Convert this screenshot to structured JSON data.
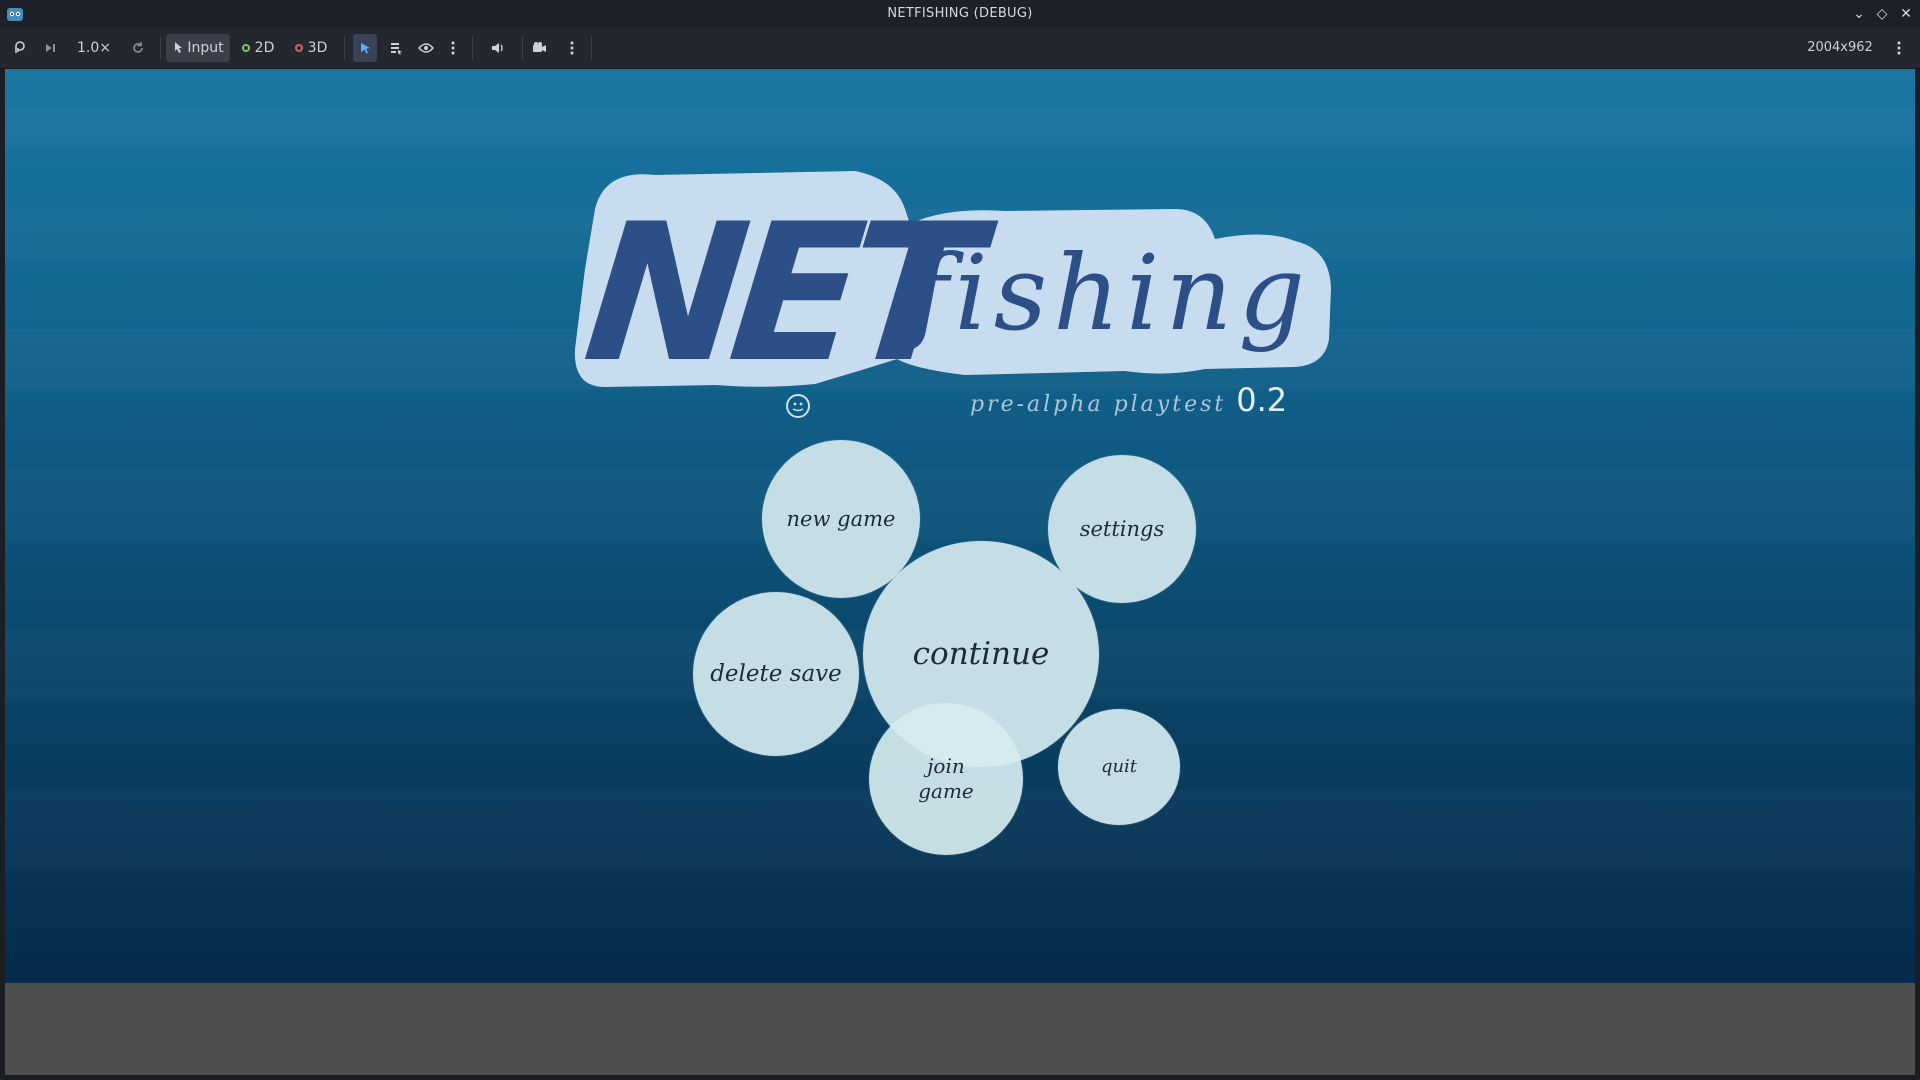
{
  "window": {
    "title": "NETFISHING (DEBUG)"
  },
  "toolbar": {
    "speed": "1.0×",
    "input_label": "Input",
    "mode_2d": "2D",
    "mode_3d": "3D",
    "resolution": "2004x962"
  },
  "game": {
    "logo_net": "NET",
    "logo_fishing": "fishing",
    "subtitle": "pre-alpha playtest",
    "version": "0.2",
    "menu": {
      "new_game": "new game",
      "settings": "settings",
      "continue": "continue",
      "delete_save": "delete save",
      "join_game": "join\ngame",
      "quit": "quit"
    }
  },
  "colors": {
    "bubble": "#c5dde4",
    "logo_outline": "#c8dcef",
    "logo_text": "#2b4f86",
    "ocean_top": "#1b76a2",
    "ocean_bottom": "#062b4b"
  }
}
